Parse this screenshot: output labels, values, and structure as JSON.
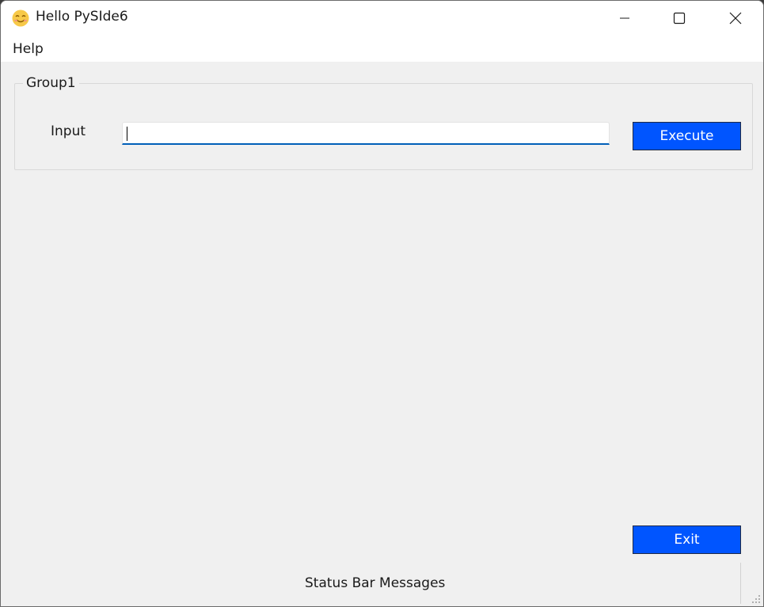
{
  "window": {
    "title": "Hello PySIde6",
    "app_icon": "smiling-face-icon",
    "controls": {
      "minimize_icon": "minimize-icon",
      "maximize_icon": "maximize-icon",
      "close_icon": "close-icon"
    }
  },
  "menubar": {
    "items": [
      {
        "label": "Help"
      }
    ]
  },
  "group": {
    "title": "Group1",
    "input_label": "Input",
    "input_value": "",
    "execute_label": "Execute"
  },
  "footer": {
    "exit_label": "Exit",
    "status_message": "Status Bar Messages"
  },
  "colors": {
    "accent": "#0055ff",
    "input_focus": "#005fb8",
    "background": "#f0f0f0"
  }
}
